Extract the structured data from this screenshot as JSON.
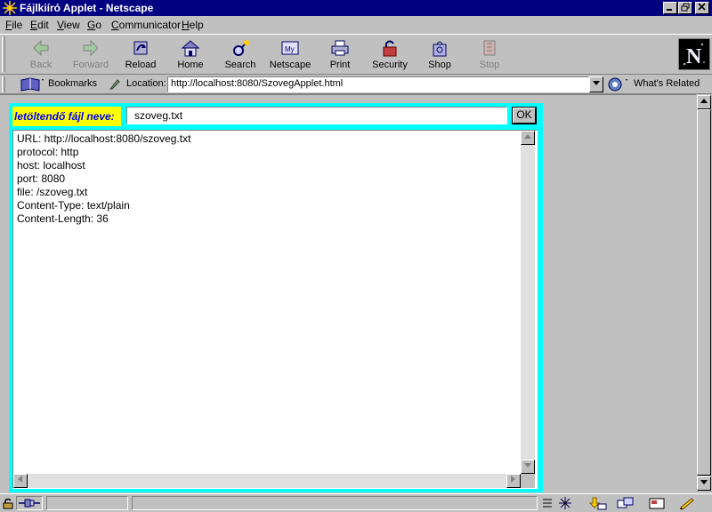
{
  "window": {
    "title": "Fájlkiíró Applet - Netscape"
  },
  "menu": [
    {
      "accel": "F",
      "rest": "ile"
    },
    {
      "accel": "E",
      "rest": "dit"
    },
    {
      "accel": "V",
      "rest": "iew"
    },
    {
      "accel": "G",
      "rest": "o"
    },
    {
      "accel": "C",
      "rest": "ommunicator"
    },
    {
      "accel": "H",
      "rest": "elp"
    }
  ],
  "toolbar": {
    "back": "Back",
    "forward": "Forward",
    "reload": "Reload",
    "home": "Home",
    "search": "Search",
    "netscape": "Netscape",
    "print": "Print",
    "security": "Security",
    "shop": "Shop",
    "stop": "Stop",
    "logo": "N"
  },
  "location": {
    "bookmarks": "Bookmarks",
    "label": "Location:",
    "url": "http://localhost:8080/SzovegApplet.html",
    "whats_related": "What's Related"
  },
  "applet": {
    "label": "letöltendő fájl neve:",
    "filename": "szoveg.txt",
    "ok": "OK",
    "lines": [
      "URL: http://localhost:8080/szoveg.txt",
      "protocol: http",
      "host: localhost",
      "port: 8080",
      "file: /szoveg.txt",
      "Content-Type: text/plain",
      "Content-Length: 36"
    ]
  },
  "colors": {
    "titlebar": "#000080",
    "applet_bg": "#00ffff",
    "label_bg": "#ffff00",
    "label_text": "#0000ff"
  }
}
